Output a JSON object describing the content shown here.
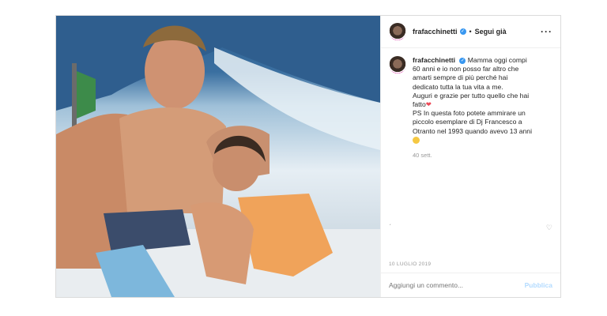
{
  "post": {
    "username": "frafacchinetti",
    "follow_label": "Segui già",
    "caption_lines": [
      "Mamma oggi compi",
      "60 anni e io non posso far altro che",
      "amarti sempre di più perché hai",
      "dedicato tutta la tua vita a me.",
      "Auguri e grazie per tutto quello che hai",
      "fatto",
      "PS In questa foto potete ammirare un",
      "piccolo esemplare di Dj Francesco a",
      "Otranto nel 1993 quando avevo 13 anni"
    ],
    "time_ago": "40 sett.",
    "date": "10 LUGLIO 2019",
    "comment_placeholder": "Aggiungi un commento...",
    "publish_label": "Pubblica"
  }
}
